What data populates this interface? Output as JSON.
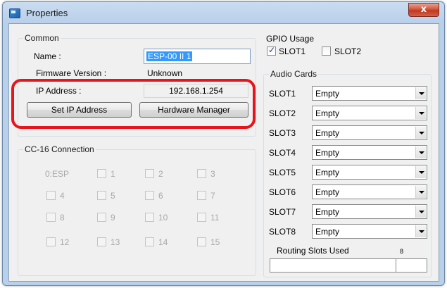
{
  "window": {
    "title": "Properties",
    "close_glyph": "x"
  },
  "common": {
    "group_label": "Common",
    "name_label": "Name :",
    "name_value": "ESP-00 II 1",
    "firmware_label": "Firmware Version :",
    "firmware_value": "Unknown",
    "ip_label": "IP Address :",
    "ip_value": "192.168.1.254",
    "set_ip_button": "Set IP Address",
    "hardware_manager_button": "Hardware Manager"
  },
  "cc16": {
    "group_label": "CC-16 Connection",
    "esp_label": "0:ESP",
    "checkboxes": [
      "1",
      "2",
      "3",
      "4",
      "5",
      "6",
      "7",
      "8",
      "9",
      "10",
      "11",
      "12",
      "13",
      "14",
      "15"
    ]
  },
  "gpio": {
    "group_label": "GPIO Usage",
    "slot1_label": "SLOT1",
    "slot1_checked": true,
    "slot2_label": "SLOT2",
    "slot2_checked": false
  },
  "audio_cards": {
    "group_label": "Audio Cards",
    "slots": [
      {
        "label": "SLOT1",
        "value": "Empty"
      },
      {
        "label": "SLOT2",
        "value": "Empty"
      },
      {
        "label": "SLOT3",
        "value": "Empty"
      },
      {
        "label": "SLOT4",
        "value": "Empty"
      },
      {
        "label": "SLOT5",
        "value": "Empty"
      },
      {
        "label": "SLOT6",
        "value": "Empty"
      },
      {
        "label": "SLOT7",
        "value": "Empty"
      },
      {
        "label": "SLOT8",
        "value": "Empty"
      }
    ]
  },
  "routing": {
    "label": "Routing Slots Used",
    "max_label": "8"
  },
  "colors": {
    "highlight": "#e8141b",
    "selection": "#3399ff",
    "close_button": "#c2381f"
  }
}
